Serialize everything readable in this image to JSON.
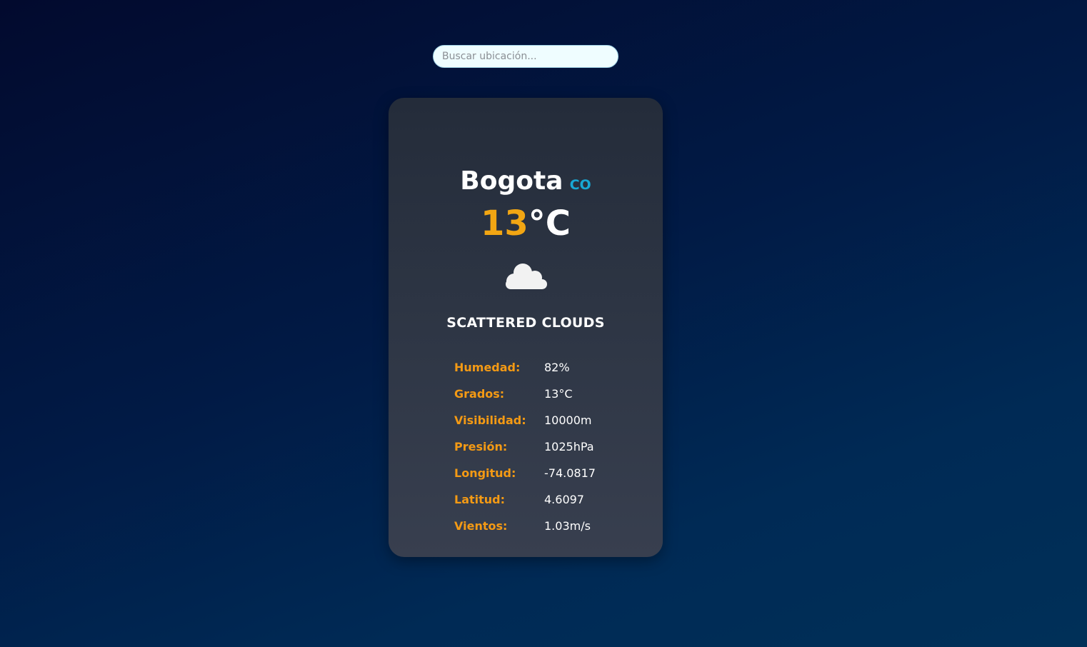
{
  "search": {
    "placeholder": "Buscar ubicación..."
  },
  "weather": {
    "city": "Bogota",
    "country": "CO",
    "temperature": "13",
    "temperature_unit": "°C",
    "icon": "cloud-icon",
    "description": "SCATTERED CLOUDS"
  },
  "details": [
    {
      "label": "Humedad:",
      "value": "82%"
    },
    {
      "label": "Grados:",
      "value": "13°C"
    },
    {
      "label": "Visibilidad:",
      "value": "10000m"
    },
    {
      "label": "Presión:",
      "value": "1025hPa"
    },
    {
      "label": "Longitud:",
      "value": "-74.0817"
    },
    {
      "label": "Latitud:",
      "value": "4.6097"
    },
    {
      "label": "Vientos:",
      "value": "1.03m/s"
    }
  ],
  "colors": {
    "accent_temperature": "#f2a613",
    "label_color": "#f49a14",
    "country_color": "#18a8d4"
  }
}
